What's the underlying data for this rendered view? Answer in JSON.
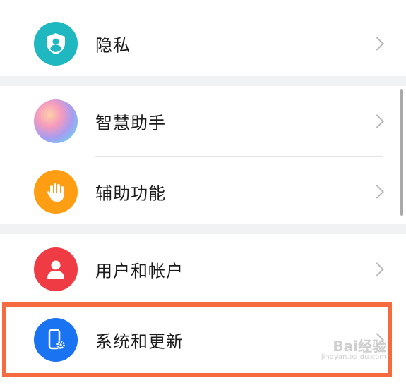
{
  "settings": {
    "items": [
      {
        "label": "隐私",
        "icon": "privacy-shield-icon",
        "color": "#1fb8c0"
      },
      {
        "label": "智慧助手",
        "icon": "assistant-orb-icon",
        "color": "#b996ec"
      },
      {
        "label": "辅助功能",
        "icon": "hand-icon",
        "color": "#ff9d13"
      },
      {
        "label": "用户和帐户",
        "icon": "user-icon",
        "color": "#ef3b44"
      },
      {
        "label": "系统和更新",
        "icon": "system-phone-icon",
        "color": "#1a73f0"
      }
    ]
  },
  "highlight_color": "#f56a3f",
  "watermark": {
    "logo": "Bai经验",
    "url": "jingyan.baidu.com"
  }
}
